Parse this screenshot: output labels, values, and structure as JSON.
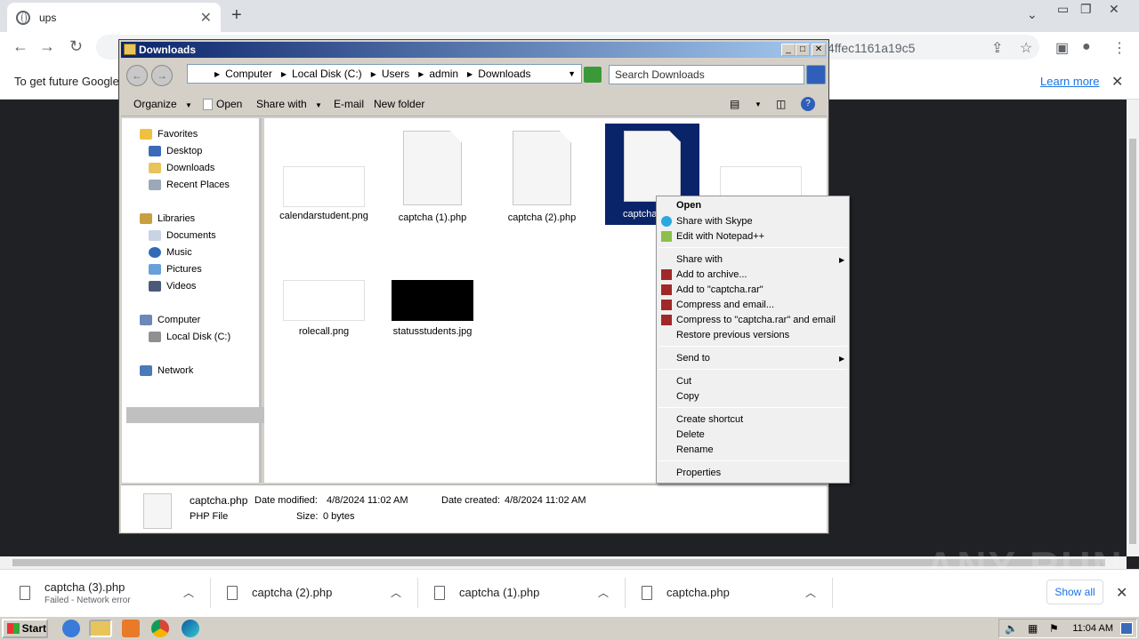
{
  "browser": {
    "tab_title": "ups",
    "url_tail": "4ffec1161a19c5",
    "infobar_text": "To get future Google",
    "learn_more": "Learn more",
    "watermark": "ANY RUN"
  },
  "explorer": {
    "title": "Downloads",
    "breadcrumb": [
      "Computer",
      "Local Disk (C:)",
      "Users",
      "admin",
      "Downloads"
    ],
    "search_placeholder": "Search Downloads",
    "commands": {
      "organize": "Organize",
      "open": "Open",
      "share_with": "Share with",
      "email": "E-mail",
      "new_folder": "New folder"
    },
    "nav": {
      "favorites": "Favorites",
      "desktop": "Desktop",
      "downloads": "Downloads",
      "recent": "Recent Places",
      "libraries": "Libraries",
      "documents": "Documents",
      "music": "Music",
      "pictures": "Pictures",
      "videos": "Videos",
      "computer": "Computer",
      "local_disk": "Local Disk (C:)",
      "network": "Network"
    },
    "files": {
      "f1": "calendarstudent.png",
      "f2": "captcha (1).php",
      "f3": "captcha (2).php",
      "f4": "captcha",
      "f6": "rolecall.png",
      "f7": "statusstudents.jpg"
    },
    "details": {
      "name": "captcha.php",
      "modified_label": "Date modified:",
      "modified": "4/8/2024 11:02 AM",
      "created_label": "Date created:",
      "created": "4/8/2024 11:02 AM",
      "type": "PHP File",
      "size_label": "Size:",
      "size": "0 bytes"
    }
  },
  "context_menu": {
    "open": "Open",
    "skype": "Share with Skype",
    "notepad": "Edit with Notepad++",
    "share_with": "Share with",
    "add_archive": "Add to archive...",
    "add_rar": "Add to \"captcha.rar\"",
    "compress_email": "Compress and email...",
    "compress_rar_email": "Compress to \"captcha.rar\" and email",
    "restore": "Restore previous versions",
    "send_to": "Send to",
    "cut": "Cut",
    "copy": "Copy",
    "create_shortcut": "Create shortcut",
    "delete": "Delete",
    "rename": "Rename",
    "properties": "Properties"
  },
  "downloads": {
    "items": [
      {
        "name": "captcha (3).php",
        "status": "Failed - Network error"
      },
      {
        "name": "captcha (2).php"
      },
      {
        "name": "captcha (1).php"
      },
      {
        "name": "captcha.php"
      }
    ],
    "show_all": "Show all"
  },
  "taskbar": {
    "start": "Start",
    "clock": "11:04 AM"
  }
}
